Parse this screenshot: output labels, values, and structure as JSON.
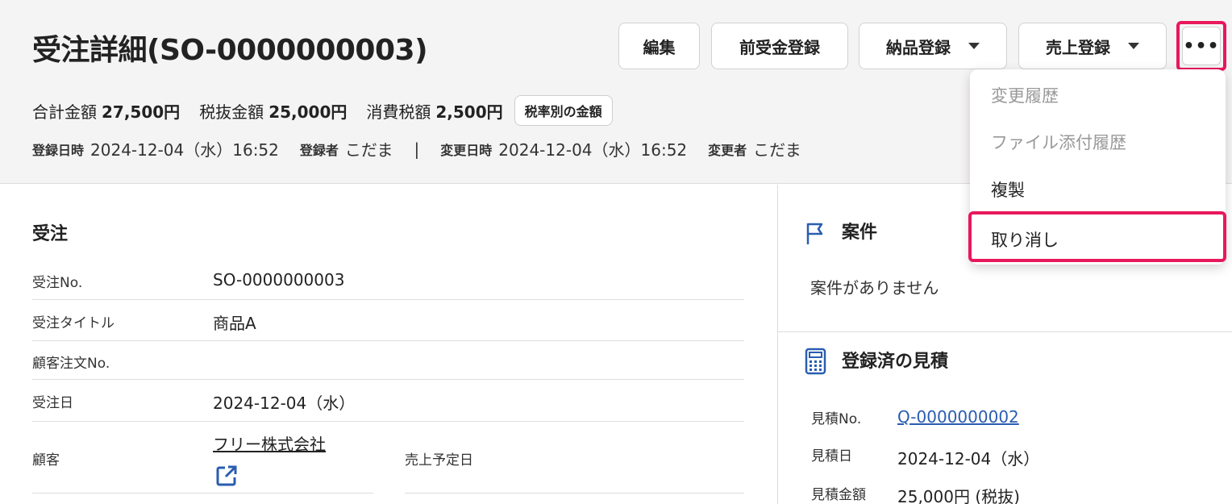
{
  "header": {
    "title": "受注詳細(SO-0000000003)",
    "buttons": {
      "edit": "編集",
      "advance": "前受金登録",
      "delivery": "納品登録",
      "sales": "売上登録",
      "more": "•••"
    },
    "amounts": {
      "total_label": "合計金額",
      "total_value": "27,500円",
      "excl_label": "税抜金額",
      "excl_value": "25,000円",
      "tax_label": "消費税額",
      "tax_value": "2,500円",
      "tax_rate_badge": "税率別の金額"
    },
    "meta": {
      "created_label": "登録日時",
      "created_value": "2024-12-04（水）16:52",
      "creator_label": "登録者",
      "creator_value": "こだま",
      "separator": "|",
      "updated_label": "変更日時",
      "updated_value": "2024-12-04（水）16:52",
      "updater_label": "変更者",
      "updater_value": "こだま"
    }
  },
  "order": {
    "section_title": "受注",
    "fields": {
      "no_label": "受注No.",
      "no_value": "SO-0000000003",
      "title_label": "受注タイトル",
      "title_value": "商品A",
      "customer_order_label": "顧客注文No.",
      "date_label": "受注日",
      "date_value": "2024-12-04（水）",
      "customer_label": "顧客",
      "customer_value": "フリー株式会社",
      "sales_date_label": "売上予定日"
    }
  },
  "project": {
    "title": "案件",
    "empty": "案件がありません"
  },
  "quotes": {
    "title": "登録済の見積",
    "no_label": "見積No.",
    "no_value": "Q-0000000002",
    "date_label": "見積日",
    "date_value": "2024-12-04（水）",
    "amount_label": "見積金額",
    "amount_value": "25,000円 (税抜)"
  },
  "menu": {
    "items": [
      "変更履歴",
      "ファイル添付履歴",
      "複製",
      "取り消し"
    ]
  },
  "colors": {
    "accent": "#2a5db0",
    "highlight": "#e8185c",
    "header_bg": "#f5f4f4"
  }
}
